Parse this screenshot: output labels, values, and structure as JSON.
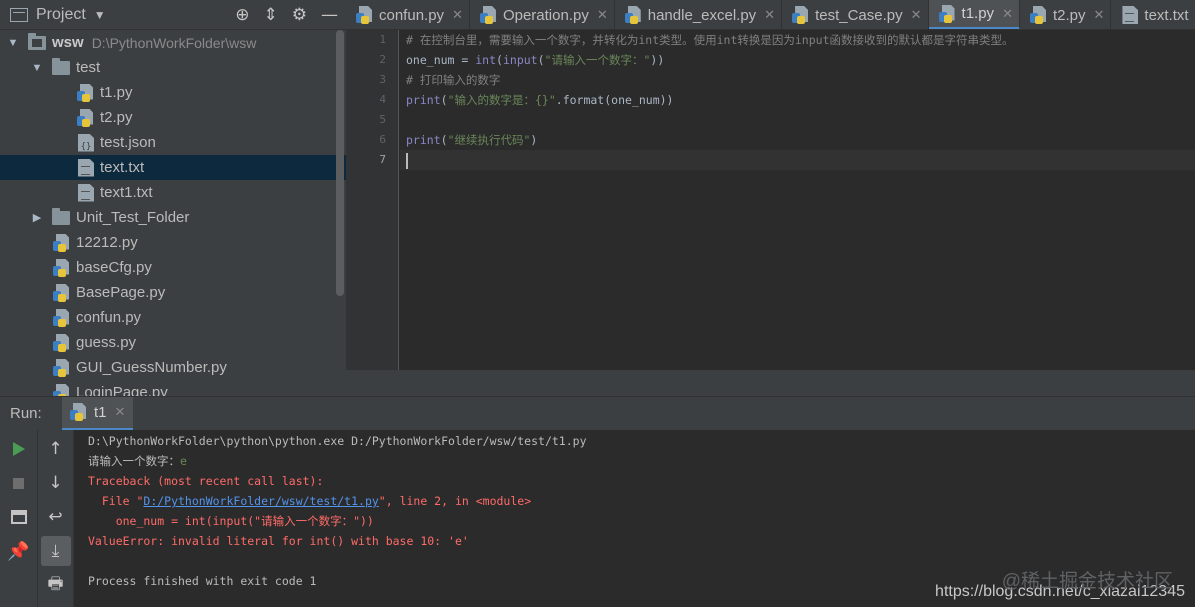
{
  "project_panel": {
    "title": "Project",
    "tree": [
      {
        "label": "wsw",
        "path": "D:\\PythonWorkFolder\\wsw",
        "type": "module-folder",
        "depth": 0,
        "expanded": true
      },
      {
        "label": "test",
        "type": "folder",
        "depth": 1,
        "expanded": true
      },
      {
        "label": "t1.py",
        "type": "py",
        "depth": 2
      },
      {
        "label": "t2.py",
        "type": "py",
        "depth": 2
      },
      {
        "label": "test.json",
        "type": "json",
        "depth": 2
      },
      {
        "label": "text.txt",
        "type": "txt",
        "depth": 2,
        "selected": true
      },
      {
        "label": "text1.txt",
        "type": "txt",
        "depth": 2
      },
      {
        "label": "Unit_Test_Folder",
        "type": "folder",
        "depth": 1,
        "expanded": false
      },
      {
        "label": "12212.py",
        "type": "py",
        "depth": 1
      },
      {
        "label": "baseCfg.py",
        "type": "py",
        "depth": 1
      },
      {
        "label": "BasePage.py",
        "type": "py",
        "depth": 1
      },
      {
        "label": "confun.py",
        "type": "py",
        "depth": 1
      },
      {
        "label": "guess.py",
        "type": "py",
        "depth": 1
      },
      {
        "label": "GUI_GuessNumber.py",
        "type": "py",
        "depth": 1
      },
      {
        "label": "LoginPage.py",
        "type": "py",
        "depth": 1
      }
    ]
  },
  "editor_tabs": [
    {
      "label": "confun.py",
      "type": "py"
    },
    {
      "label": "Operation.py",
      "type": "py"
    },
    {
      "label": "handle_excel.py",
      "type": "py"
    },
    {
      "label": "test_Case.py",
      "type": "py"
    },
    {
      "label": "t1.py",
      "type": "py",
      "active": true
    },
    {
      "label": "t2.py",
      "type": "py"
    },
    {
      "label": "text.txt",
      "type": "txt"
    }
  ],
  "code": {
    "line_numbers": [
      "1",
      "2",
      "3",
      "4",
      "5",
      "6",
      "7"
    ],
    "current_line": 7,
    "lines": [
      [
        {
          "t": "# 在控制台里，需要输入一个数字，并转化为int类型。使用int转换是因为input函数接收到的默认都是字符串类型。",
          "c": "com"
        }
      ],
      [
        {
          "t": "one_num = ",
          "c": "def"
        },
        {
          "t": "int",
          "c": "fn"
        },
        {
          "t": "(",
          "c": "def"
        },
        {
          "t": "input",
          "c": "fn"
        },
        {
          "t": "(",
          "c": "def"
        },
        {
          "t": "\"请输入一个数字：\"",
          "c": "str"
        },
        {
          "t": "))",
          "c": "def"
        }
      ],
      [
        {
          "t": "# 打印输入的数字",
          "c": "com"
        }
      ],
      [
        {
          "t": "print",
          "c": "fn"
        },
        {
          "t": "(",
          "c": "def"
        },
        {
          "t": "\"输入的数字是：{}\"",
          "c": "str"
        },
        {
          "t": ".format(one_num))",
          "c": "def"
        }
      ],
      [],
      [
        {
          "t": "print",
          "c": "fn"
        },
        {
          "t": "(",
          "c": "def"
        },
        {
          "t": "\"继续执行代码\"",
          "c": "str"
        },
        {
          "t": ")",
          "c": "def"
        }
      ],
      []
    ]
  },
  "run_panel": {
    "label": "Run:",
    "tab_label": "t1",
    "console": {
      "command": "D:\\PythonWorkFolder\\python\\python.exe D:/PythonWorkFolder/wsw/test/t1.py",
      "prompt": "请输入一个数字：",
      "user_input": "e",
      "traceback_header": "Traceback (most recent call last):",
      "file_prefix": "  File \"",
      "file_link": "D:/PythonWorkFolder/wsw/test/t1.py",
      "file_suffix": "\", line 2, in <module>",
      "code_line": "    one_num = int(input(\"请输入一个数字：\"))",
      "error": "ValueError: invalid literal for int() with base 10: 'e'",
      "exit": "Process finished with exit code 1"
    }
  },
  "watermark": {
    "url": "https://blog.csdn.net/c_xiazai12345",
    "cn": "@稀土掘金技术社区"
  },
  "colors": {
    "background": "#2b2b2b",
    "panel": "#3c3f41",
    "selection": "#0d293e",
    "accent": "#4a88c7",
    "error": "#ff6b68",
    "string": "#6a8759",
    "comment": "#808080",
    "builtin": "#8888c6"
  }
}
